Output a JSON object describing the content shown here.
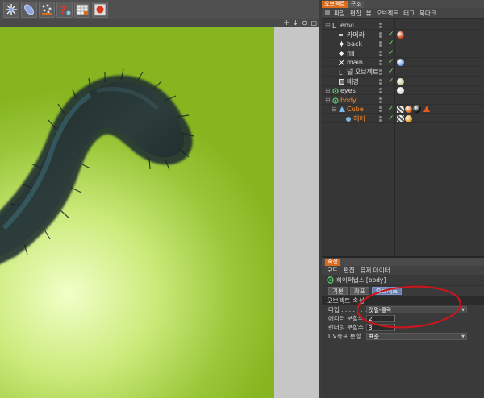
{
  "colors": {
    "accent": "#d96b1c",
    "selected_text": "#ff8a2a",
    "check": "#7ee06a",
    "annotation": "#c8161e",
    "viewport_bg": "#9ac73a"
  },
  "toolbar": {
    "icons": [
      "deformer-tool-icon",
      "primitive-capsule-icon",
      "particle-emitter-icon",
      "hair-tool-icon",
      "render-region-icon",
      "render-view-icon"
    ]
  },
  "viewport": {
    "nav_icons": "✛ ↓ ⊙ ▢"
  },
  "object_manager": {
    "tabs": [
      "오브젝트",
      "구조"
    ],
    "menu": [
      "파일",
      "편집",
      "뷰",
      "오브젝트",
      "태그",
      "북마크"
    ],
    "objects": [
      {
        "label": "envi",
        "icon": "null-icon",
        "indent": 0,
        "selected": false,
        "tree": "⊟"
      },
      {
        "label": "카메라",
        "icon": "camera-icon",
        "indent": 1,
        "selected": false,
        "tree": ""
      },
      {
        "label": "back",
        "icon": "light-icon",
        "indent": 1,
        "selected": false,
        "tree": ""
      },
      {
        "label": "fill",
        "icon": "light-icon",
        "indent": 1,
        "selected": false,
        "tree": ""
      },
      {
        "label": "main",
        "icon": "spot-light-icon",
        "indent": 1,
        "selected": false,
        "tree": ""
      },
      {
        "label": "널 오브젝트",
        "icon": "null-icon",
        "indent": 1,
        "selected": false,
        "tree": ""
      },
      {
        "label": "배경",
        "icon": "background-icon",
        "indent": 1,
        "selected": false,
        "tree": ""
      },
      {
        "label": "eyes",
        "icon": "hypernurbs-icon",
        "indent": 0,
        "selected": false,
        "tree": "⊞"
      },
      {
        "label": "body",
        "icon": "hypernurbs-icon",
        "indent": 0,
        "selected": true,
        "tree": "⊟"
      },
      {
        "label": "Cube",
        "icon": "cube-icon",
        "indent": 1,
        "selected": true,
        "tree": "⊟"
      },
      {
        "label": "헤어",
        "icon": "hair-icon",
        "indent": 2,
        "selected": true,
        "tree": ""
      }
    ]
  },
  "attributes": {
    "panel_tab": "속성",
    "menu": [
      "모드",
      "편집",
      "유저 데이터"
    ],
    "object_line": "하이퍼넙스 [body]",
    "tabs": [
      "기본",
      "좌표",
      "오브젝트"
    ],
    "active_tab": 2,
    "section": "오브젝트 속성",
    "props": [
      {
        "label": "타입 . . . . . . . . . .",
        "value": "캣멀-클락",
        "kind": "dropdown"
      },
      {
        "label": "에디터 분할수",
        "value": "2",
        "kind": "number"
      },
      {
        "label": "렌더링 분할수",
        "value": "3",
        "kind": "number"
      },
      {
        "label": "UV좌표 분할",
        "value": "표준",
        "kind": "dropdown"
      }
    ]
  }
}
